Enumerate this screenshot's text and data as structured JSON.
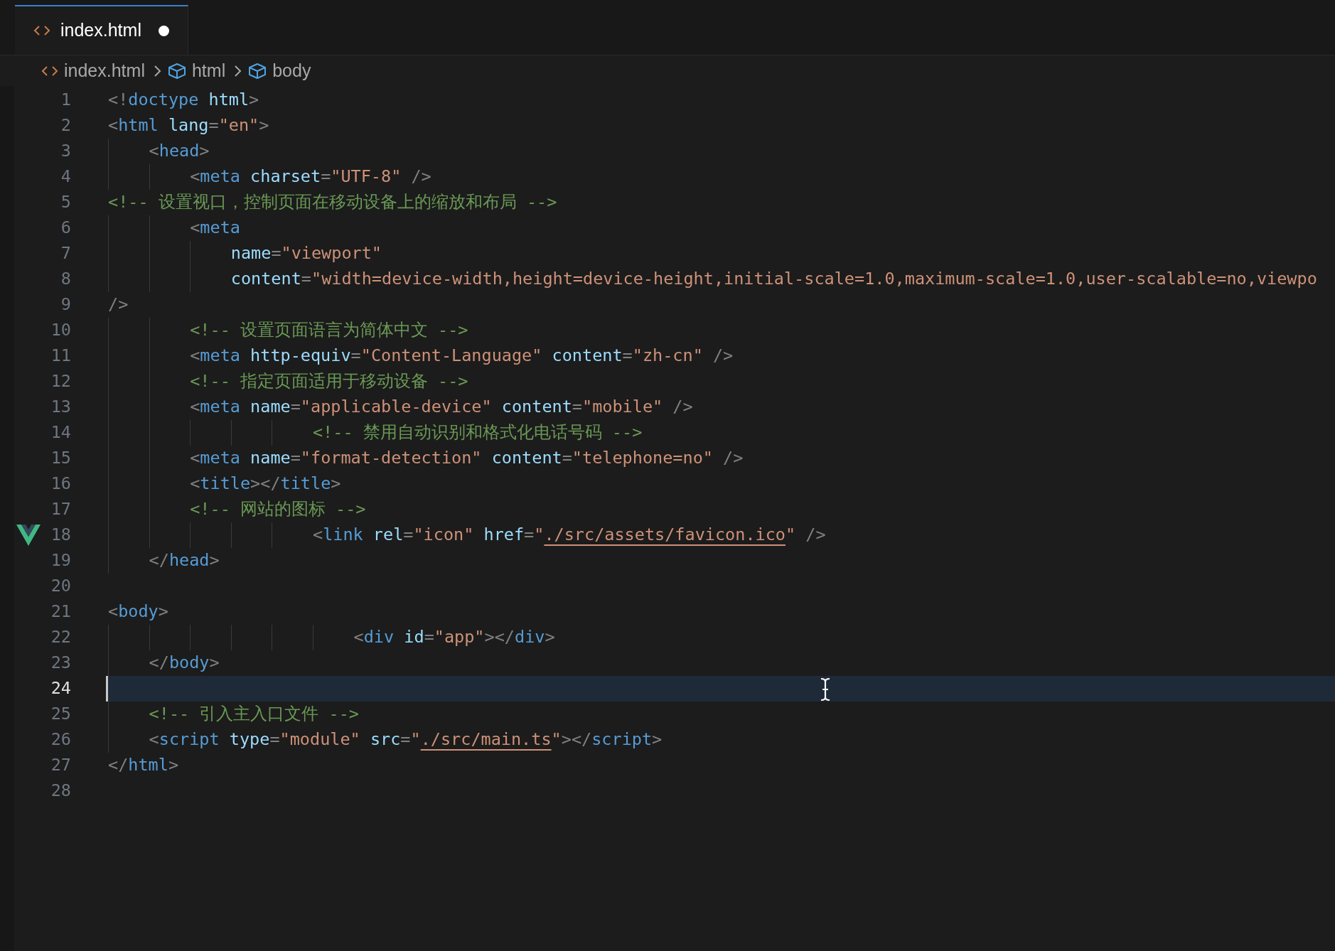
{
  "tabs": [
    {
      "label": "index.html",
      "selected": true,
      "modified": true
    }
  ],
  "breadcrumbs": [
    {
      "label": "index.html",
      "kind": "file"
    },
    {
      "label": "html",
      "kind": "element"
    },
    {
      "label": "body",
      "kind": "element"
    }
  ],
  "editor": {
    "lines": [
      {
        "number": "1",
        "active": false,
        "tokens": [
          {
            "kind": "punct",
            "text": "<!"
          },
          {
            "kind": "tag",
            "text": "doctype"
          },
          {
            "kind": "attr",
            "text": " html"
          },
          {
            "kind": "punct",
            "text": ">"
          }
        ]
      },
      {
        "number": "2",
        "active": false,
        "tokens": [
          {
            "kind": "punct",
            "text": "<"
          },
          {
            "kind": "tag",
            "text": "html"
          },
          {
            "kind": "attr",
            "text": " lang"
          },
          {
            "kind": "punct",
            "text": "="
          },
          {
            "kind": "string",
            "text": "\"en\""
          },
          {
            "kind": "punct",
            "text": ">"
          }
        ]
      },
      {
        "number": "3",
        "active": false,
        "tokens": [
          {
            "kind": "punct",
            "text": "    <"
          },
          {
            "kind": "tag",
            "text": "head"
          },
          {
            "kind": "punct",
            "text": ">"
          }
        ]
      },
      {
        "number": "4",
        "active": false,
        "tokens": [
          {
            "kind": "punct",
            "text": "        <"
          },
          {
            "kind": "tag",
            "text": "meta"
          },
          {
            "kind": "attr",
            "text": " charset"
          },
          {
            "kind": "punct",
            "text": "="
          },
          {
            "kind": "string",
            "text": "\"UTF-8\""
          },
          {
            "kind": "punct",
            "text": " />"
          }
        ]
      },
      {
        "number": "5",
        "active": false,
        "tokens": [
          {
            "kind": "comment",
            "text": "<!-- 设置视口，控制页面在移动设备上的缩放和布局 -->"
          }
        ]
      },
      {
        "number": "6",
        "active": false,
        "tokens": [
          {
            "kind": "punct",
            "text": "        <"
          },
          {
            "kind": "tag",
            "text": "meta"
          }
        ]
      },
      {
        "number": "7",
        "active": false,
        "tokens": [
          {
            "kind": "attr",
            "text": "            name"
          },
          {
            "kind": "punct",
            "text": "="
          },
          {
            "kind": "string",
            "text": "\"viewport\""
          }
        ]
      },
      {
        "number": "8",
        "active": false,
        "tokens": [
          {
            "kind": "attr",
            "text": "            content"
          },
          {
            "kind": "punct",
            "text": "="
          },
          {
            "kind": "string",
            "text": "\"width=device-width,height=device-height,initial-scale=1.0,maximum-scale=1.0,user-scalable=no,viewpo"
          }
        ]
      },
      {
        "number": "9",
        "active": false,
        "tokens": [
          {
            "kind": "punct",
            "text": "/>"
          }
        ]
      },
      {
        "number": "10",
        "active": false,
        "tokens": [
          {
            "kind": "comment",
            "text": "        <!-- 设置页面语言为简体中文 -->"
          }
        ]
      },
      {
        "number": "11",
        "active": false,
        "tokens": [
          {
            "kind": "punct",
            "text": "        <"
          },
          {
            "kind": "tag",
            "text": "meta"
          },
          {
            "kind": "attr",
            "text": " http-equiv"
          },
          {
            "kind": "punct",
            "text": "="
          },
          {
            "kind": "string",
            "text": "\"Content-Language\""
          },
          {
            "kind": "attr",
            "text": " content"
          },
          {
            "kind": "punct",
            "text": "="
          },
          {
            "kind": "string",
            "text": "\"zh-cn\""
          },
          {
            "kind": "punct",
            "text": " />"
          }
        ]
      },
      {
        "number": "12",
        "active": false,
        "tokens": [
          {
            "kind": "comment",
            "text": "        <!-- 指定页面适用于移动设备 -->"
          }
        ]
      },
      {
        "number": "13",
        "active": false,
        "tokens": [
          {
            "kind": "punct",
            "text": "        <"
          },
          {
            "kind": "tag",
            "text": "meta"
          },
          {
            "kind": "attr",
            "text": " name"
          },
          {
            "kind": "punct",
            "text": "="
          },
          {
            "kind": "string",
            "text": "\"applicable-device\""
          },
          {
            "kind": "attr",
            "text": " content"
          },
          {
            "kind": "punct",
            "text": "="
          },
          {
            "kind": "string",
            "text": "\"mobile\""
          },
          {
            "kind": "punct",
            "text": " />"
          }
        ]
      },
      {
        "number": "14",
        "active": false,
        "tokens": [
          {
            "kind": "comment",
            "text": "                    <!-- 禁用自动识别和格式化电话号码 -->"
          }
        ]
      },
      {
        "number": "15",
        "active": false,
        "tokens": [
          {
            "kind": "punct",
            "text": "        <"
          },
          {
            "kind": "tag",
            "text": "meta"
          },
          {
            "kind": "attr",
            "text": " name"
          },
          {
            "kind": "punct",
            "text": "="
          },
          {
            "kind": "string",
            "text": "\"format-detection\""
          },
          {
            "kind": "attr",
            "text": " content"
          },
          {
            "kind": "punct",
            "text": "="
          },
          {
            "kind": "string",
            "text": "\"telephone=no\""
          },
          {
            "kind": "punct",
            "text": " />"
          }
        ]
      },
      {
        "number": "16",
        "active": false,
        "tokens": [
          {
            "kind": "punct",
            "text": "        <"
          },
          {
            "kind": "tag",
            "text": "title"
          },
          {
            "kind": "punct",
            "text": "></"
          },
          {
            "kind": "tag",
            "text": "title"
          },
          {
            "kind": "punct",
            "text": ">"
          }
        ]
      },
      {
        "number": "17",
        "active": false,
        "tokens": [
          {
            "kind": "comment",
            "text": "        <!-- 网站的图标 -->"
          }
        ]
      },
      {
        "number": "18",
        "active": false,
        "gutter_icon": true,
        "tokens": [
          {
            "kind": "punct",
            "text": "                    <"
          },
          {
            "kind": "tag",
            "text": "link"
          },
          {
            "kind": "attr",
            "text": " rel"
          },
          {
            "kind": "punct",
            "text": "="
          },
          {
            "kind": "string",
            "text": "\"icon\""
          },
          {
            "kind": "attr",
            "text": " href"
          },
          {
            "kind": "punct",
            "text": "="
          },
          {
            "kind": "string",
            "text": "\""
          },
          {
            "kind": "link",
            "text": "./src/assets/favicon.ico"
          },
          {
            "kind": "string",
            "text": "\""
          },
          {
            "kind": "punct",
            "text": " />"
          }
        ]
      },
      {
        "number": "19",
        "active": false,
        "tokens": [
          {
            "kind": "punct",
            "text": "    </"
          },
          {
            "kind": "tag",
            "text": "head"
          },
          {
            "kind": "punct",
            "text": ">"
          }
        ]
      },
      {
        "number": "20",
        "active": false
      },
      {
        "number": "21",
        "active": false,
        "tokens": [
          {
            "kind": "punct",
            "text": "<"
          },
          {
            "kind": "tag",
            "text": "body"
          },
          {
            "kind": "punct",
            "text": ">"
          }
        ]
      },
      {
        "number": "22",
        "active": false,
        "tokens": [
          {
            "kind": "punct",
            "text": "                        <"
          },
          {
            "kind": "tag",
            "text": "div"
          },
          {
            "kind": "attr",
            "text": " id"
          },
          {
            "kind": "punct",
            "text": "="
          },
          {
            "kind": "string",
            "text": "\"app\""
          },
          {
            "kind": "punct",
            "text": "></"
          },
          {
            "kind": "tag",
            "text": "div"
          },
          {
            "kind": "punct",
            "text": ">"
          }
        ]
      },
      {
        "number": "23",
        "active": false,
        "tokens": [
          {
            "kind": "punct",
            "text": "    </"
          },
          {
            "kind": "tag",
            "text": "body"
          },
          {
            "kind": "punct",
            "text": ">"
          }
        ]
      },
      {
        "number": "24",
        "active": true
      },
      {
        "number": "25",
        "active": false,
        "tokens": [
          {
            "kind": "comment",
            "text": "    <!-- 引入主入口文件 -->"
          }
        ]
      },
      {
        "number": "26",
        "active": false,
        "tokens": [
          {
            "kind": "punct",
            "text": "    <"
          },
          {
            "kind": "tag",
            "text": "script"
          },
          {
            "kind": "attr",
            "text": " type"
          },
          {
            "kind": "punct",
            "text": "="
          },
          {
            "kind": "string",
            "text": "\"module\""
          },
          {
            "kind": "attr",
            "text": " src"
          },
          {
            "kind": "punct",
            "text": "="
          },
          {
            "kind": "string",
            "text": "\""
          },
          {
            "kind": "link",
            "text": "./src/main.ts"
          },
          {
            "kind": "string",
            "text": "\""
          },
          {
            "kind": "punct",
            "text": "></"
          },
          {
            "kind": "tag",
            "text": "script"
          },
          {
            "kind": "punct",
            "text": ">"
          }
        ]
      },
      {
        "number": "27",
        "active": false,
        "tokens": [
          {
            "kind": "punct",
            "text": "</"
          },
          {
            "kind": "tag",
            "text": "html"
          },
          {
            "kind": "punct",
            "text": ">"
          }
        ]
      },
      {
        "number": "28",
        "active": false
      }
    ]
  }
}
